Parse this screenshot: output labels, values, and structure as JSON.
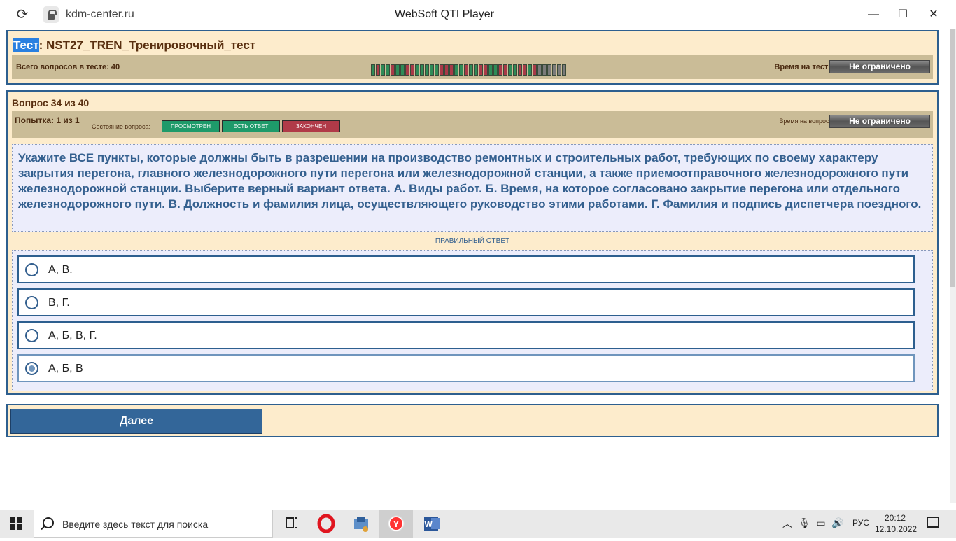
{
  "window": {
    "url": "kdm-center.ru",
    "title": "WebSoft QTI Player",
    "minimize": "—",
    "maximize": "☐",
    "close": "✕"
  },
  "test": {
    "title_highlight": "Тест",
    "title_rest": ": NST27_TREN_Тренировочный_тест",
    "total_label": "Всего вопросов в тесте: 40",
    "time_label": "Время на тест:",
    "time_value": "Не ограничено",
    "progress": [
      "g",
      "r",
      "g",
      "g",
      "r",
      "g",
      "g",
      "r",
      "r",
      "g",
      "g",
      "g",
      "g",
      "g",
      "r",
      "r",
      "r",
      "g",
      "g",
      "r",
      "g",
      "g",
      "r",
      "r",
      "g",
      "g",
      "r",
      "r",
      "g",
      "g",
      "r",
      "r",
      "g",
      "r",
      "x",
      "x",
      "x",
      "x",
      "x",
      "x"
    ]
  },
  "question": {
    "number": "Вопрос 34 из 40",
    "attempt": "Попытка: 1 из 1",
    "state_label": "Состояние вопроса:",
    "states": [
      "ПРОСМОТРЕН",
      "ЕСТЬ ОТВЕТ",
      "ЗАКОНЧЕН"
    ],
    "time_label": "Время на вопрос:",
    "time_value": "Не ограничено",
    "text": "Укажите ВСЕ пункты, которые должны быть в разрешении на производство ремонтных и строительных работ, требующих по своему характеру закрытия перегона, главного железнодорожного пути перегона или железнодорожной станции, а также приемоотправочного железнодорожного пути железнодорожной станции. Выберите верный вариант ответа. А. Виды работ. Б. Время, на которое согласовано закрытие перегона или отдельного железнодорожного пути. В. Должность и фамилия лица, осуществляющего руководство этими работами. Г. Фамилия и подпись диспетчера поездного.",
    "answer_caption": "ПРАВИЛЬНЫЙ ОТВЕТ",
    "answers": [
      {
        "label": "А, В.",
        "selected": false
      },
      {
        "label": "В, Г.",
        "selected": false
      },
      {
        "label": "А, Б, В, Г.",
        "selected": false
      },
      {
        "label": "А, Б, В",
        "selected": true
      }
    ]
  },
  "nav": {
    "next_label": "Далее"
  },
  "taskbar": {
    "search_placeholder": "Введите здесь текст для поиска",
    "lang": "РУС",
    "time": "20:12",
    "date": "12.10.2022"
  },
  "colors": {
    "panel_bg": "#fdeccc",
    "panel_border": "#2d5f8f",
    "strip_bg": "#cabc97",
    "question_text": "#34608f",
    "state_viewed": "#1e9a6a",
    "state_answered": "#1e9a6a",
    "state_finished": "#b03a48"
  }
}
